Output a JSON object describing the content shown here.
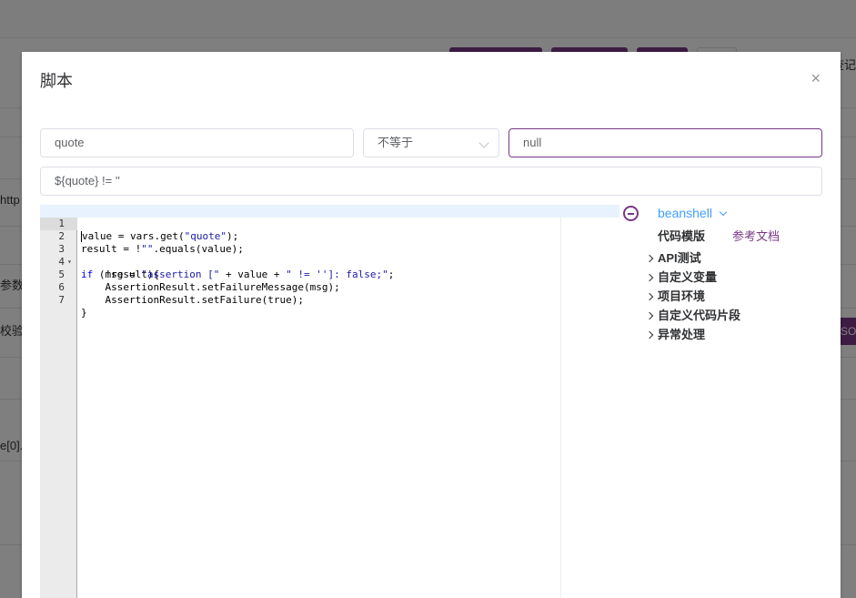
{
  "background": {
    "fragments": [
      "http",
      "参数",
      "校验响",
      "e[0]."
    ],
    "right_text": "查记",
    "right_button": "SO"
  },
  "dialog": {
    "title": "脚本",
    "close_symbol": "×"
  },
  "assertion": {
    "variable_value": "quote",
    "operator_value": "不等于",
    "expected_value": "null",
    "script_expression": "${quote} != ''"
  },
  "editor": {
    "lines": [
      {
        "n": "1",
        "code": "value = vars.get(\"quote\");"
      },
      {
        "n": "2",
        "code": "result = !\"\".equals(value);"
      },
      {
        "n": "3",
        "code": "if (!result){"
      },
      {
        "n": "4",
        "code": "    msg = \"assertion [\" + value + \" != '']: false;\";"
      },
      {
        "n": "5",
        "code": "    AssertionResult.setFailureMessage(msg);"
      },
      {
        "n": "6",
        "code": "    AssertionResult.setFailure(true);"
      },
      {
        "n": "7",
        "code": "}"
      }
    ],
    "fold_symbol": "▾"
  },
  "panel": {
    "language": "beanshell",
    "template_title": "代码模版",
    "doc_link": "参考文档",
    "tree": [
      "API测试",
      "自定义变量",
      "项目环境",
      "自定义代码片段",
      "异常处理"
    ]
  },
  "colors": {
    "brand": "#783887",
    "link": "#409eff"
  }
}
